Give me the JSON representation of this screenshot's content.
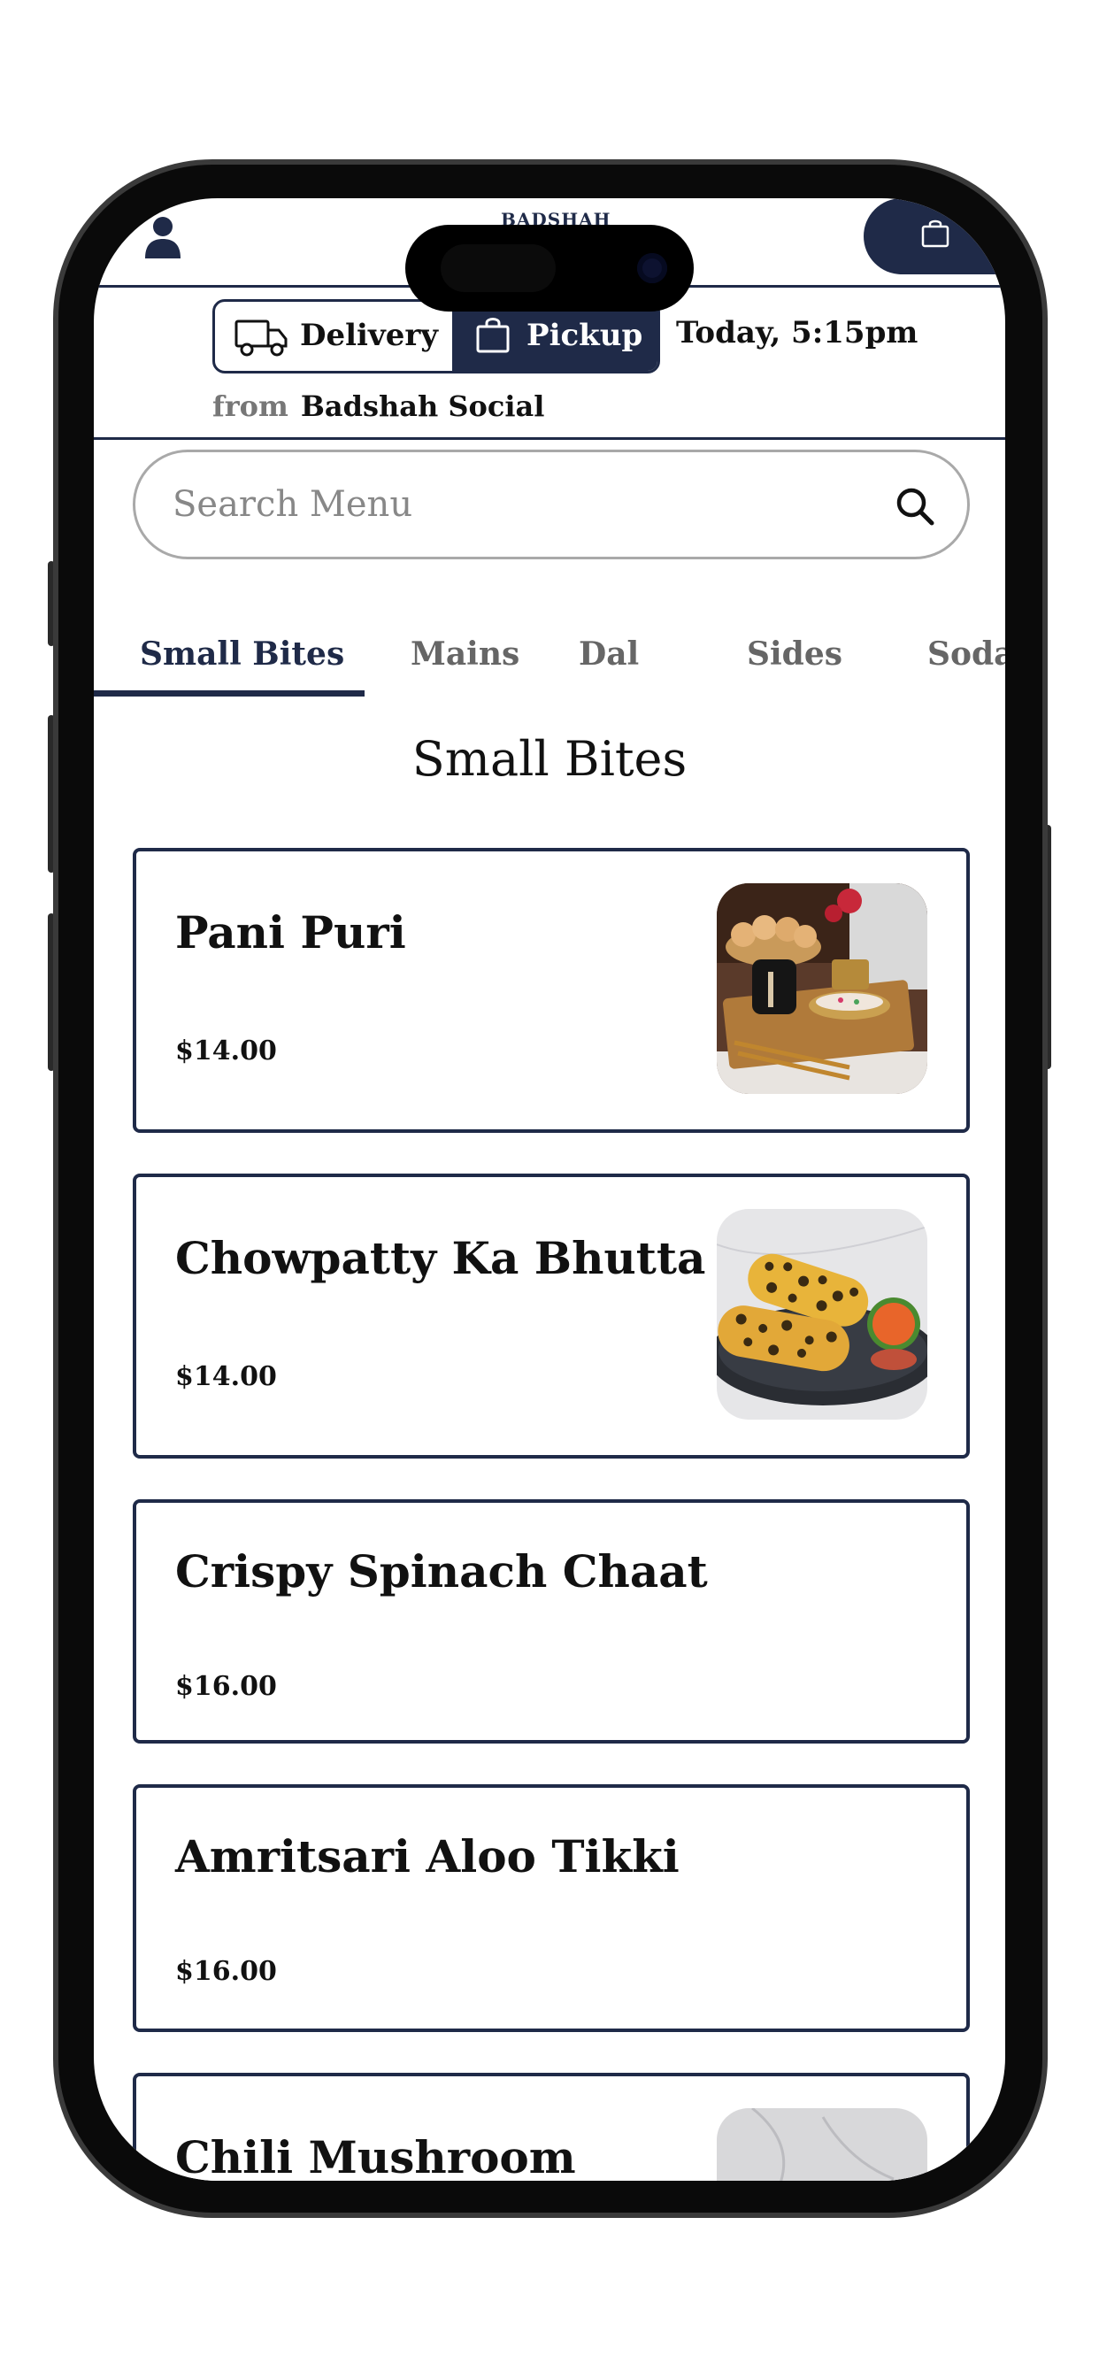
{
  "app": {
    "logo_text": "BADSHAH"
  },
  "order": {
    "delivery_label": "Delivery",
    "pickup_label": "Pickup",
    "selected": "Pickup",
    "time_label": "Today, 5:15pm",
    "from_label": "from",
    "location": "Badshah Social"
  },
  "search": {
    "placeholder": "Search Menu"
  },
  "tabs": [
    {
      "label": "Small Bites",
      "active": true
    },
    {
      "label": "Mains",
      "active": false
    },
    {
      "label": "Dal",
      "active": false
    },
    {
      "label": "Sides",
      "active": false
    },
    {
      "label": "Soda",
      "active": false
    }
  ],
  "section": {
    "title": "Small Bites"
  },
  "items": [
    {
      "name": "Pani Puri",
      "price": "$14.00",
      "image": "pani-puri-photo"
    },
    {
      "name": "Chowpatty Ka Bhutta",
      "price": "$14.00",
      "image": "grilled-corn-photo"
    },
    {
      "name": "Crispy Spinach Chaat",
      "price": "$16.00"
    },
    {
      "name": "Amritsari Aloo Tikki",
      "price": "$16.00"
    },
    {
      "name": "Chili Mushroom",
      "image": "chili-mushroom-photo"
    }
  ],
  "colors": {
    "brand_navy": "#1f2a48",
    "text": "#111111",
    "muted": "#777777"
  }
}
